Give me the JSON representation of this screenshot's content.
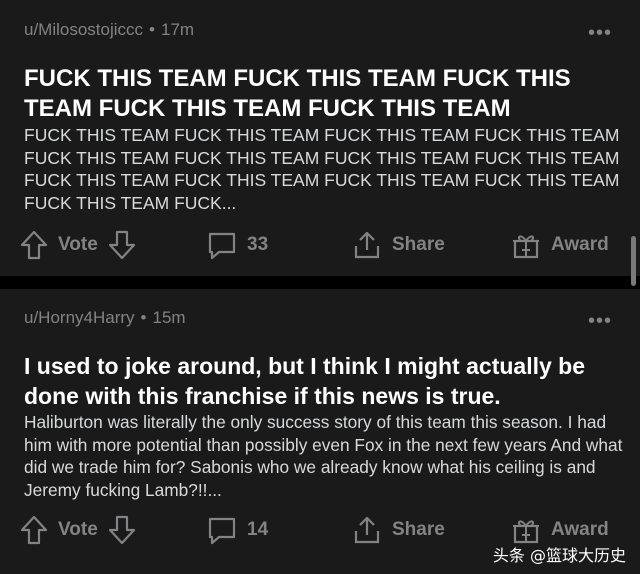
{
  "posts": [
    {
      "username": "u/Milosostojiccc",
      "separator": "•",
      "time": "17m",
      "title": "FUCK THIS TEAM FUCK THIS TEAM FUCK THIS TEAM FUCK THIS TEAM FUCK THIS TEAM",
      "body": "FUCK THIS TEAM FUCK THIS TEAM FUCK THIS TEAM FUCK THIS TEAM FUCK THIS TEAM FUCK THIS TEAM FUCK THIS TEAM FUCK THIS TEAM FUCK THIS TEAM FUCK THIS TEAM FUCK THIS TEAM FUCK THIS TEAM FUCK THIS TEAM FUCK...",
      "vote_label": "Vote",
      "comment_count": "33",
      "share_label": "Share",
      "award_label": "Award"
    },
    {
      "username": "u/Horny4Harry",
      "separator": "•",
      "time": "15m",
      "title": "I used to joke around, but I think I might actually be done with this franchise if this news is true.",
      "body": "Haliburton was literally the only success story of this team this season. I had him with more potential than possibly even Fox in the next few years And what did we trade him for? Sabonis who we already know what his ceiling is and Jeremy fucking Lamb?!!...",
      "vote_label": "Vote",
      "comment_count": "14",
      "share_label": "Share",
      "award_label": "Award"
    }
  ],
  "more_icon": "•••",
  "watermark": "头条 @篮球大历史",
  "colors": {
    "background": "#000000",
    "card": "#1a1a1b",
    "text": "#d7dadc",
    "muted": "#818384"
  }
}
